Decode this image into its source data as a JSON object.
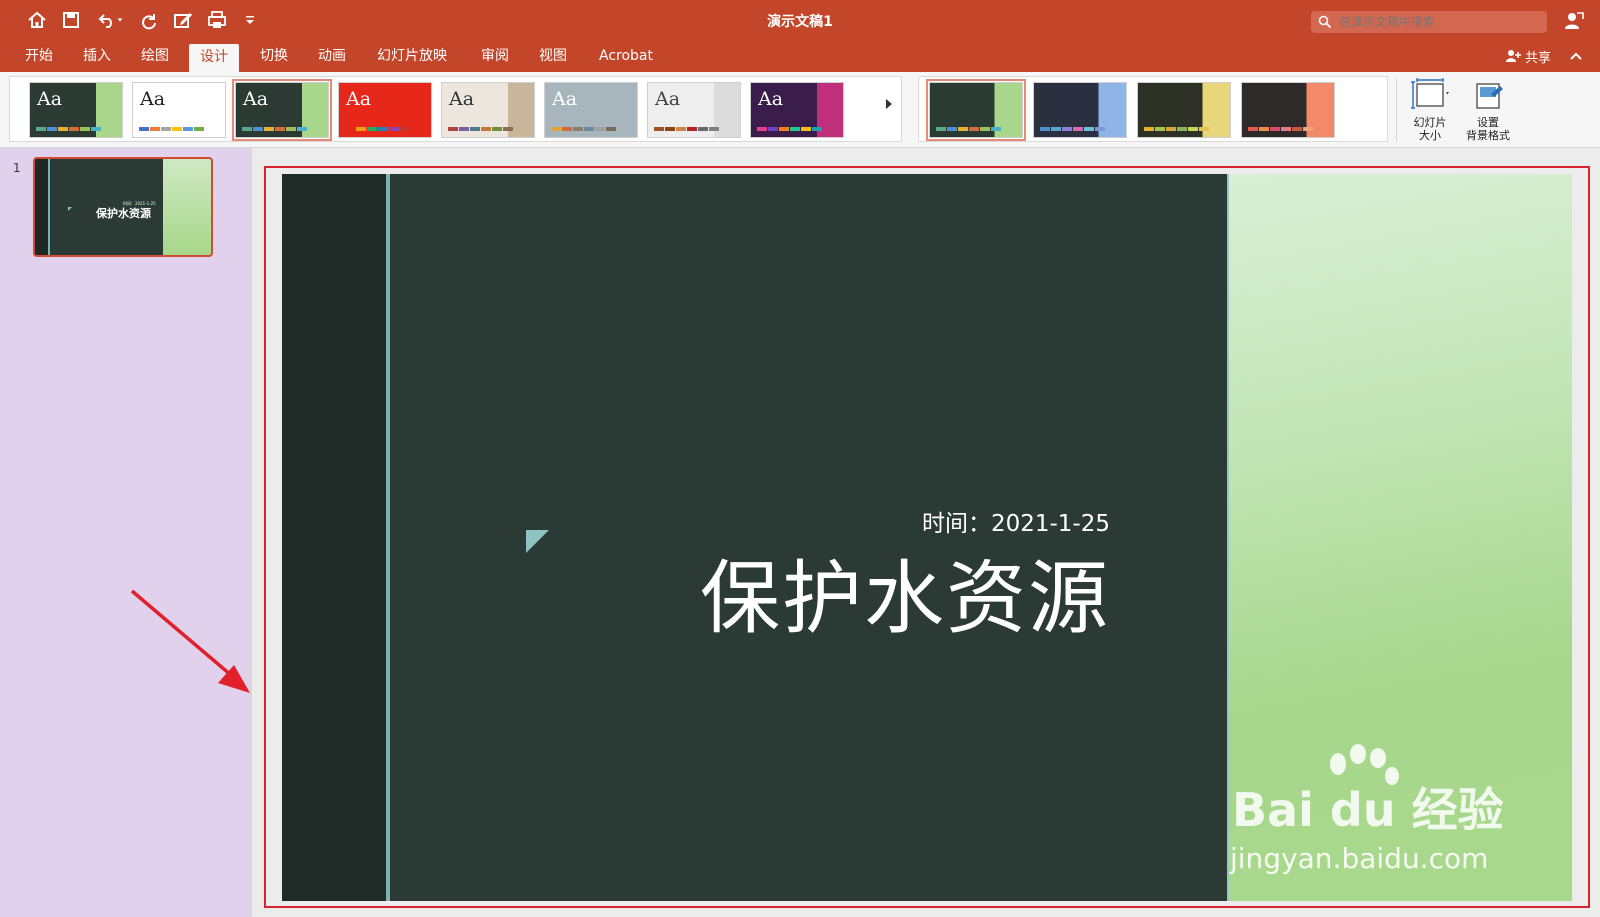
{
  "window": {
    "title": "演示文稿1"
  },
  "search": {
    "placeholder": "在演示文稿中搜索"
  },
  "tabs": [
    "开始",
    "插入",
    "绘图",
    "设计",
    "切换",
    "动画",
    "幻灯片放映",
    "审阅",
    "视图",
    "Acrobat"
  ],
  "active_tab": "设计",
  "share": {
    "label": "共享"
  },
  "themes": {
    "thumb_label": "Aa",
    "items": [
      {
        "bg": "#2b3a33",
        "accent": "#a8d68a",
        "text": "#ffffff",
        "bars": [
          "#5aa88a",
          "#4f8fd6",
          "#e6b12f",
          "#d96a3a",
          "#9bc25a",
          "#4bb0c8"
        ]
      },
      {
        "bg": "#ffffff",
        "accent": "#ffffff",
        "text": "#222222",
        "bars": [
          "#4472c4",
          "#ed7d31",
          "#a5a5a5",
          "#ffc000",
          "#5b9bd5",
          "#70ad47"
        ]
      },
      {
        "bg": "#2b3a33",
        "accent": "#a8d68a",
        "text": "#ffffff",
        "bars": [
          "#5aa88a",
          "#4f8fd6",
          "#e6b12f",
          "#d96a3a",
          "#9bc25a",
          "#4bb0c8"
        ]
      },
      {
        "bg": "#e8271b",
        "accent": "#e8271b",
        "text": "#ffffff",
        "bars": [
          "#e8271b",
          "#f39c12",
          "#27ae60",
          "#2980b9",
          "#8e44ad",
          "#c0392b"
        ]
      },
      {
        "bg": "#ece6df",
        "accent": "#c9b59c",
        "text": "#333333",
        "bars": [
          "#a9453c",
          "#7b5ea8",
          "#4d7a8c",
          "#c47a3b",
          "#6f8f3b",
          "#8c6d4f"
        ]
      },
      {
        "bg": "#a7b5bd",
        "accent": "#a7b5bd",
        "text": "#ffffff",
        "bars": [
          "#e0a63a",
          "#d66b3a",
          "#8c7c6a",
          "#6b8aa0",
          "#a0a0a0",
          "#7a6a5a"
        ]
      },
      {
        "bg": "#eeeeee",
        "accent": "#dcdcdc",
        "text": "#444444",
        "bars": [
          "#a0522d",
          "#8b4513",
          "#cd853f",
          "#b22222",
          "#696969",
          "#808080"
        ]
      },
      {
        "bg": "#3a1d4a",
        "accent": "#c0307a",
        "text": "#ffffff",
        "bars": [
          "#e83e8c",
          "#6f42c1",
          "#fd7e14",
          "#20c997",
          "#ffc107",
          "#17a2b8"
        ]
      }
    ]
  },
  "variants": [
    {
      "bg": "#2b3a33",
      "accent": "#a8d68a",
      "bars": [
        "#5aa88a",
        "#4f8fd6",
        "#e6b12f",
        "#d96a3a",
        "#9bc25a",
        "#4bb0c8"
      ]
    },
    {
      "bg": "#2a3040",
      "accent": "#8fb5e8",
      "bars": [
        "#4f8fd6",
        "#5aa8c8",
        "#8a7fd6",
        "#d66bb0",
        "#6bc2d6",
        "#7a9ad6"
      ]
    },
    {
      "bg": "#2e3126",
      "accent": "#e7d77a",
      "bars": [
        "#e6b12f",
        "#a8c24a",
        "#d6a63a",
        "#8fb55a",
        "#c8d65a",
        "#e6c24f"
      ]
    },
    {
      "bg": "#2e2a2a",
      "accent": "#f28a6a",
      "bars": [
        "#e05a4a",
        "#f08a4a",
        "#d64a6a",
        "#e67a8a",
        "#c85a3a",
        "#f0a07a"
      ]
    }
  ],
  "ribbon_buttons": {
    "slide_size": [
      "幻灯片",
      "大小"
    ],
    "format_background": [
      "设置",
      "背景格式"
    ]
  },
  "thumbnail": {
    "number": "1",
    "title": "保护水资源",
    "date": "时间：2021-1-25"
  },
  "slide": {
    "date": "时间：2021-1-25",
    "title": "保护水资源"
  },
  "watermark": {
    "logo": "Bai du 经验",
    "url": "jingyan.baidu.com"
  }
}
